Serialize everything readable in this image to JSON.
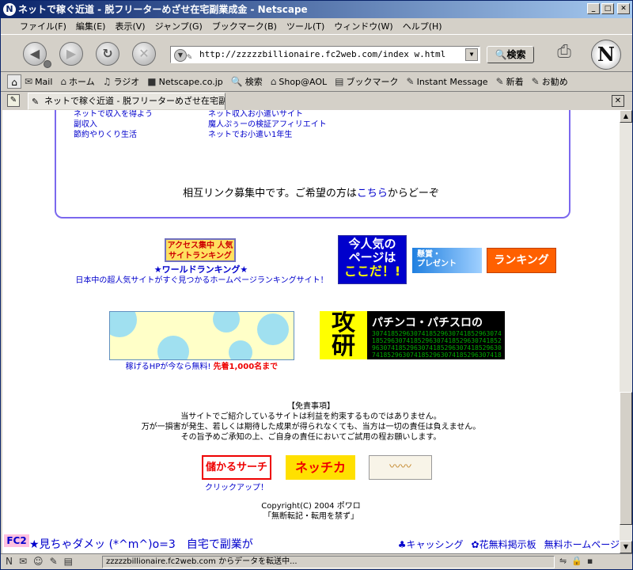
{
  "window": {
    "title": "ネットで稼ぐ近道 - 脱フリーターめざせ在宅副業成金 - Netscape",
    "app_icon": "netscape-n-icon"
  },
  "menu": [
    "ファイル(F)",
    "編集(E)",
    "表示(V)",
    "ジャンプ(G)",
    "ブックマーク(B)",
    "ツール(T)",
    "ウィンドウ(W)",
    "ヘルプ(H)"
  ],
  "nav": {
    "url": "http://zzzzzbillionaire.fc2web.com/index w.html",
    "search_label": "検索"
  },
  "personal_toolbar": [
    "Mail",
    "ホーム",
    "ラジオ",
    "Netscape.co.jp",
    "検索",
    "Shop@AOL",
    "ブックマーク",
    "Instant Message",
    "新着",
    "お勧め"
  ],
  "tab": {
    "label": "ネットで稼ぐ近道 - 脱フリーターめざせ在宅副..."
  },
  "page": {
    "links_left": [
      "ネットで収入を得よう",
      "副収入",
      "節約やりくり生活"
    ],
    "links_right": [
      "ネット収入お小遣いサイト",
      "魔人ぷぅーの検証アフィリエイト",
      "ネットでお小遣い1年生"
    ],
    "mutual_prefix": "相互リンク募集中です。ご希望の方は",
    "mutual_link": "こちら",
    "mutual_suffix": "からどーぞ",
    "access_banner": "アクセス集中 人気サイトランキング",
    "world_ranking": "★ワールドランキング★",
    "world_desc": "日本中の超人気サイトがすぐ見つかるホームページランキングサイト！",
    "ima_line1": "今人気の",
    "ima_line2": "ページは",
    "ima_line3": "ここだ！!",
    "kensho_line1": "懸賞・",
    "kensho_line2": "プレゼント",
    "ranking_banner": "ランキング",
    "dots_caption": "稼げるHPが今なら無料!",
    "dots_caption_red": "先着1,000名まで",
    "pachi_kou": "攻",
    "pachi_ken": "研",
    "pachi_text": "パチンコ・パチスロの",
    "disclaimer_title": "【免責事項】",
    "disclaimer_1": "当サイトでご紹介しているサイトは利益を約束するものではありません。",
    "disclaimer_2": "万が一損害が発生、若しくは期待した成果が得られなくても、当方は一切の責任は負えません。",
    "disclaimer_3": "その旨予めご承知の上、ご自身の責任においてご試用の程お願いします。",
    "moukaru_banner": "儲かるサーチ",
    "moukaru_caption": "クリックアップ！",
    "netchika_banner": "ネッチカ",
    "copyright": "Copyright(C) 2004 ポワロ",
    "copyright_note": "「無断転記・転用を禁ず」",
    "fc2_logo": "FC2",
    "fc2_title": "★見ちゃダメッ (*^m^)o=3　自宅で副業が",
    "fc2_links": [
      "キャッシング",
      "花無料掲示板",
      "無料ホームページ"
    ]
  },
  "status": {
    "text": "zzzzzbillionaire.fc2web.com からデータを転送中..."
  }
}
